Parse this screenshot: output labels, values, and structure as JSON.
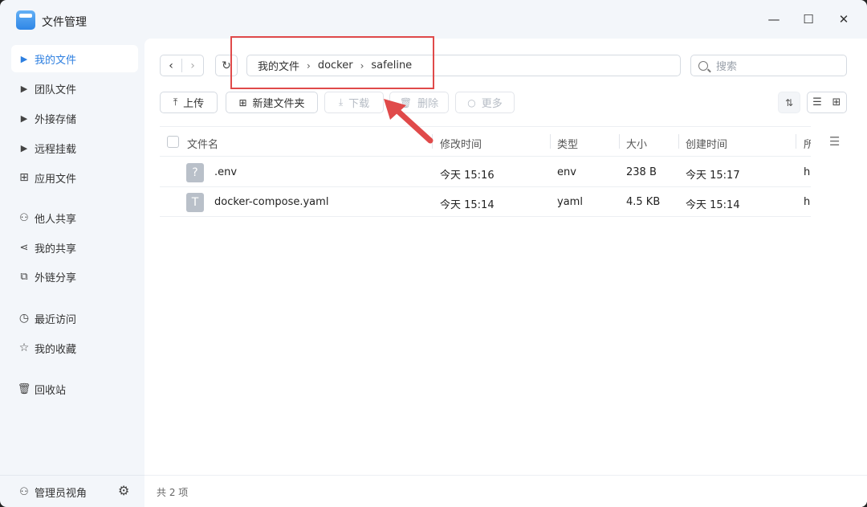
{
  "window": {
    "title": "文件管理",
    "minimize": "—",
    "maximize": "☐",
    "close": "✕"
  },
  "sidebar": {
    "items": [
      {
        "label": "我的文件",
        "icon": "caret-right-icon"
      },
      {
        "label": "团队文件",
        "icon": "caret-right-icon"
      },
      {
        "label": "外接存储",
        "icon": "caret-right-icon"
      },
      {
        "label": "远程挂载",
        "icon": "caret-right-icon"
      },
      {
        "label": "应用文件",
        "icon": "grid-icon"
      },
      {
        "label": "他人共享",
        "icon": "users-icon"
      },
      {
        "label": "我的共享",
        "icon": "share-icon"
      },
      {
        "label": "外链分享",
        "icon": "link-share-icon"
      },
      {
        "label": "最近访问",
        "icon": "clock-icon"
      },
      {
        "label": "我的收藏",
        "icon": "star-icon"
      },
      {
        "label": "回收站",
        "icon": "trash-icon"
      }
    ],
    "admin_view": "管理员视角"
  },
  "breadcrumb": [
    "我的文件",
    "docker",
    "safeline"
  ],
  "search": {
    "placeholder": "搜索"
  },
  "toolbar": {
    "upload": "上传",
    "new_folder": "新建文件夹",
    "download": "下载",
    "delete": "删除",
    "more": "更多"
  },
  "table": {
    "headers": {
      "name": "文件名",
      "modified": "修改时间",
      "type": "类型",
      "size": "大小",
      "created": "创建时间",
      "owner": "所"
    },
    "rows": [
      {
        "name": ".env",
        "icon": "?",
        "modified": "今天 15:16",
        "type": "env",
        "size": "238 B",
        "created": "今天 15:17",
        "owner": "h"
      },
      {
        "name": "docker-compose.yaml",
        "icon": "T",
        "modified": "今天 15:14",
        "type": "yaml",
        "size": "4.5 KB",
        "created": "今天 15:14",
        "owner": "h"
      }
    ]
  },
  "footer": {
    "count": "共 2 项"
  },
  "colors": {
    "accent": "#2d7fe0",
    "annotation": "#e04a4a"
  }
}
